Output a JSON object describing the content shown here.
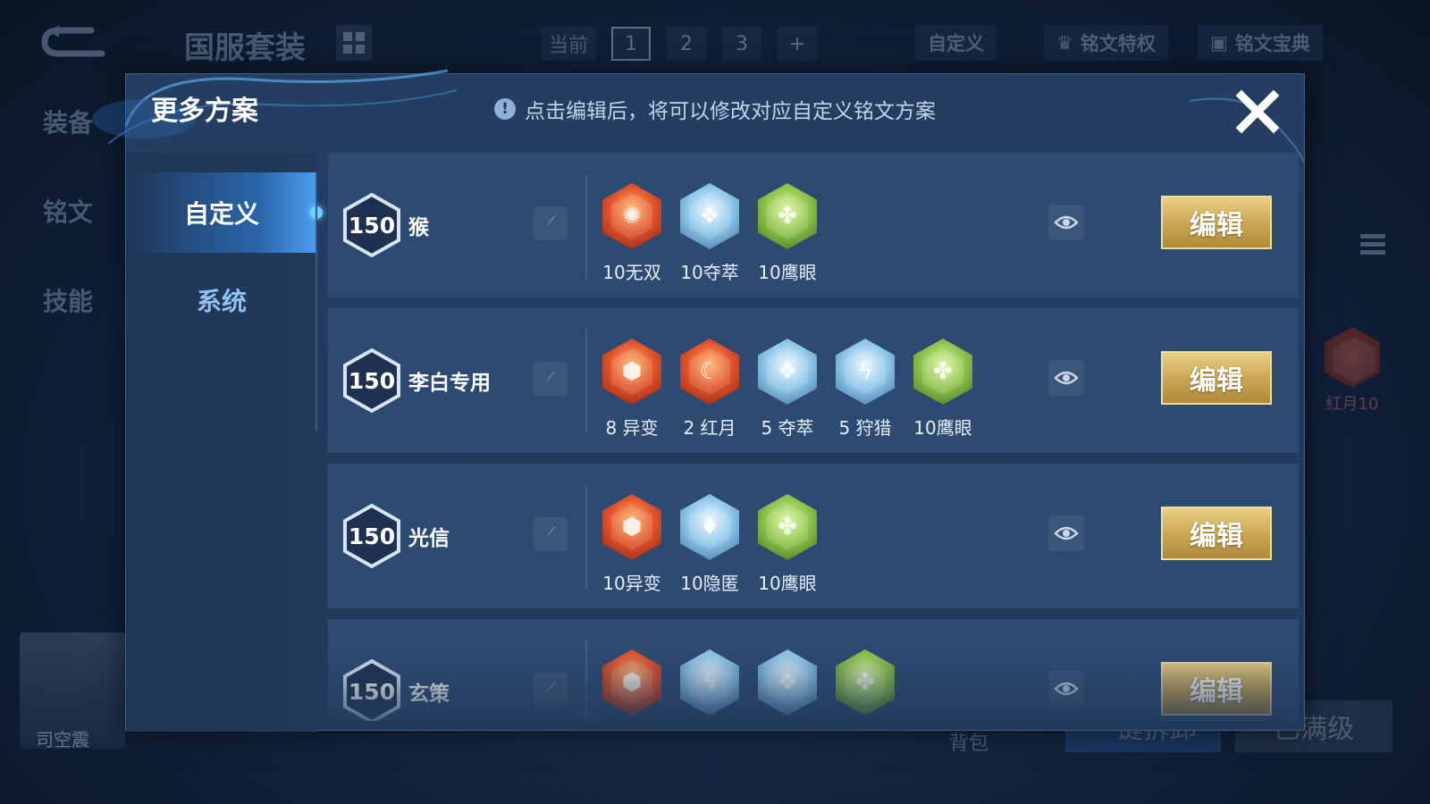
{
  "background": {
    "title": "国服套装",
    "pages": {
      "current_label": "当前",
      "items": [
        "1",
        "2",
        "3",
        "+"
      ],
      "active": "1"
    },
    "custom_btn": "自定义",
    "privilege_btn": "铭文特权",
    "codex_btn": "铭文宝典",
    "side_nav": [
      "装备",
      "铭文",
      "技能"
    ],
    "hero_name": "司空震",
    "bag_label": "背包",
    "one_click_btn": "一键拆卸",
    "max_level_btn": "已满级",
    "side_rune_label": "红月10"
  },
  "modal": {
    "title": "更多方案",
    "notice": "点击编辑后，将可以修改对应自定义铭文方案",
    "tabs": [
      {
        "label": "自定义",
        "active": true
      },
      {
        "label": "系统",
        "active": false
      }
    ],
    "rows": [
      {
        "level": "150",
        "name": "猴",
        "runes": [
          {
            "label": "10无双",
            "color": "red",
            "glyph": "✺"
          },
          {
            "label": "10夺萃",
            "color": "blue",
            "glyph": "❖"
          },
          {
            "label": "10鹰眼",
            "color": "green",
            "glyph": "✤"
          }
        ],
        "edit_label": "编辑"
      },
      {
        "level": "150",
        "name": "李白专用",
        "runes": [
          {
            "label": "8 异变",
            "color": "red",
            "glyph": "⬢"
          },
          {
            "label": "2 红月",
            "color": "red",
            "glyph": "☾"
          },
          {
            "label": "5 夺萃",
            "color": "blue",
            "glyph": "❖"
          },
          {
            "label": "5 狩猎",
            "color": "blue",
            "glyph": "ϟ"
          },
          {
            "label": "10鹰眼",
            "color": "green",
            "glyph": "✤"
          }
        ],
        "edit_label": "编辑"
      },
      {
        "level": "150",
        "name": "光信",
        "runes": [
          {
            "label": "10异变",
            "color": "red",
            "glyph": "⬢"
          },
          {
            "label": "10隐匿",
            "color": "blue",
            "glyph": "♦"
          },
          {
            "label": "10鹰眼",
            "color": "green",
            "glyph": "✤"
          }
        ],
        "edit_label": "编辑"
      },
      {
        "level": "150",
        "name": "玄策",
        "runes": [
          {
            "label": "",
            "color": "red",
            "glyph": "⬢"
          },
          {
            "label": "",
            "color": "blue",
            "glyph": "ϟ"
          },
          {
            "label": "",
            "color": "blue",
            "glyph": "❖"
          },
          {
            "label": "",
            "color": "green",
            "glyph": "✤"
          }
        ],
        "edit_label": "编辑"
      }
    ]
  },
  "colors": {
    "modal_bg": "#243e62",
    "row_bg": "#2d4a70",
    "edit_gold": "#c9a551",
    "active_tab_glow": "#6fd0ff"
  }
}
